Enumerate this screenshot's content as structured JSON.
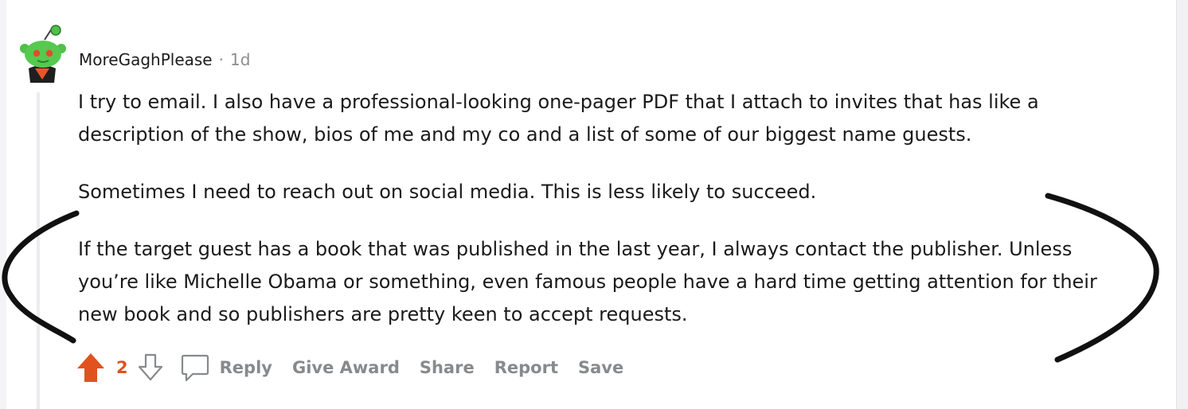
{
  "comment": {
    "username": "MoreGaghPlease",
    "separator": "·",
    "age": "1d",
    "paragraphs": [
      "I try to email. I also have a professional-looking one-pager PDF that I attach to invites that has like a description of the show, bios of me and my co and a list of some of our biggest name guests.",
      "Sometimes I need to reach out on social media. This is less likely to succeed.",
      "If the target guest has a book that was published in the last year, I always contact the publisher. Unless you’re like Michelle Obama or something, even famous people have a hard time getting attention for their new book and so publishers are pretty keen to accept requests."
    ],
    "score": "2",
    "actions": {
      "reply": "Reply",
      "give_award": "Give Award",
      "share": "Share",
      "report": "Report",
      "save": "Save"
    }
  },
  "icons": {
    "upvote": "upvote-arrow-icon",
    "downvote": "downvote-arrow-icon",
    "reply": "speech-bubble-icon",
    "avatar": "snoo-avatar"
  },
  "colors": {
    "upvote_active": "#e0531f",
    "action_gray": "#878a8c",
    "text": "#1a1a1b",
    "annotation_ink": "#111111"
  }
}
